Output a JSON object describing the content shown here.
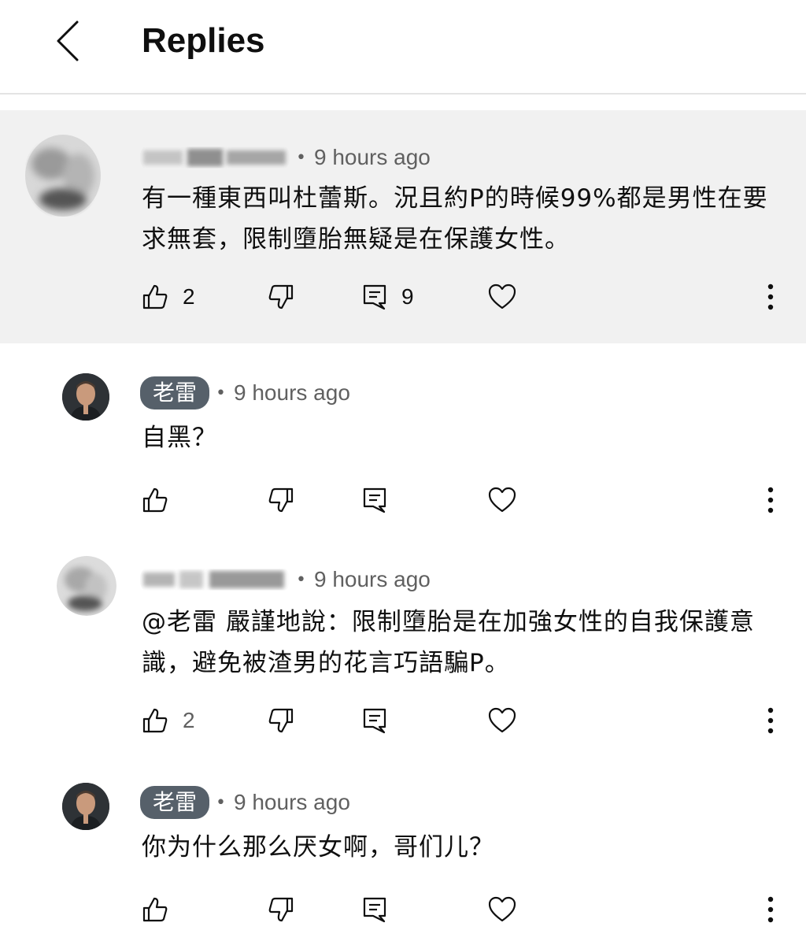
{
  "header": {
    "title": "Replies"
  },
  "comments": [
    {
      "author": "",
      "time": "9 hours ago",
      "text": "有一種東西叫杜蕾斯。況且約P的時候99%都是男性在要求無套，限制墮胎無疑是在保護女性。",
      "likes": "2",
      "replies": "9",
      "highlighted": true
    },
    {
      "author": "老雷",
      "time": "9 hours ago",
      "text": "自黑？",
      "likes": "",
      "replies": ""
    },
    {
      "author": "",
      "time": "9 hours ago",
      "text": "@老雷  嚴謹地說：限制墮胎是在加強女性的自我保護意識，避免被渣男的花言巧語騙P。",
      "likes": "2",
      "replies": ""
    },
    {
      "author": "老雷",
      "time": "9 hours ago",
      "text": "你为什么那么厌女啊，哥们儿？",
      "likes": "",
      "replies": ""
    }
  ],
  "icons": {
    "back": "chevron-left-icon",
    "like": "thumbs-up-icon",
    "dislike": "thumbs-down-icon",
    "reply": "reply-icon",
    "heart": "heart-icon",
    "more": "more-vertical-icon"
  },
  "colors": {
    "highlight_bg": "#f1f1f1",
    "chip_bg": "#56606a",
    "muted": "#606060"
  }
}
